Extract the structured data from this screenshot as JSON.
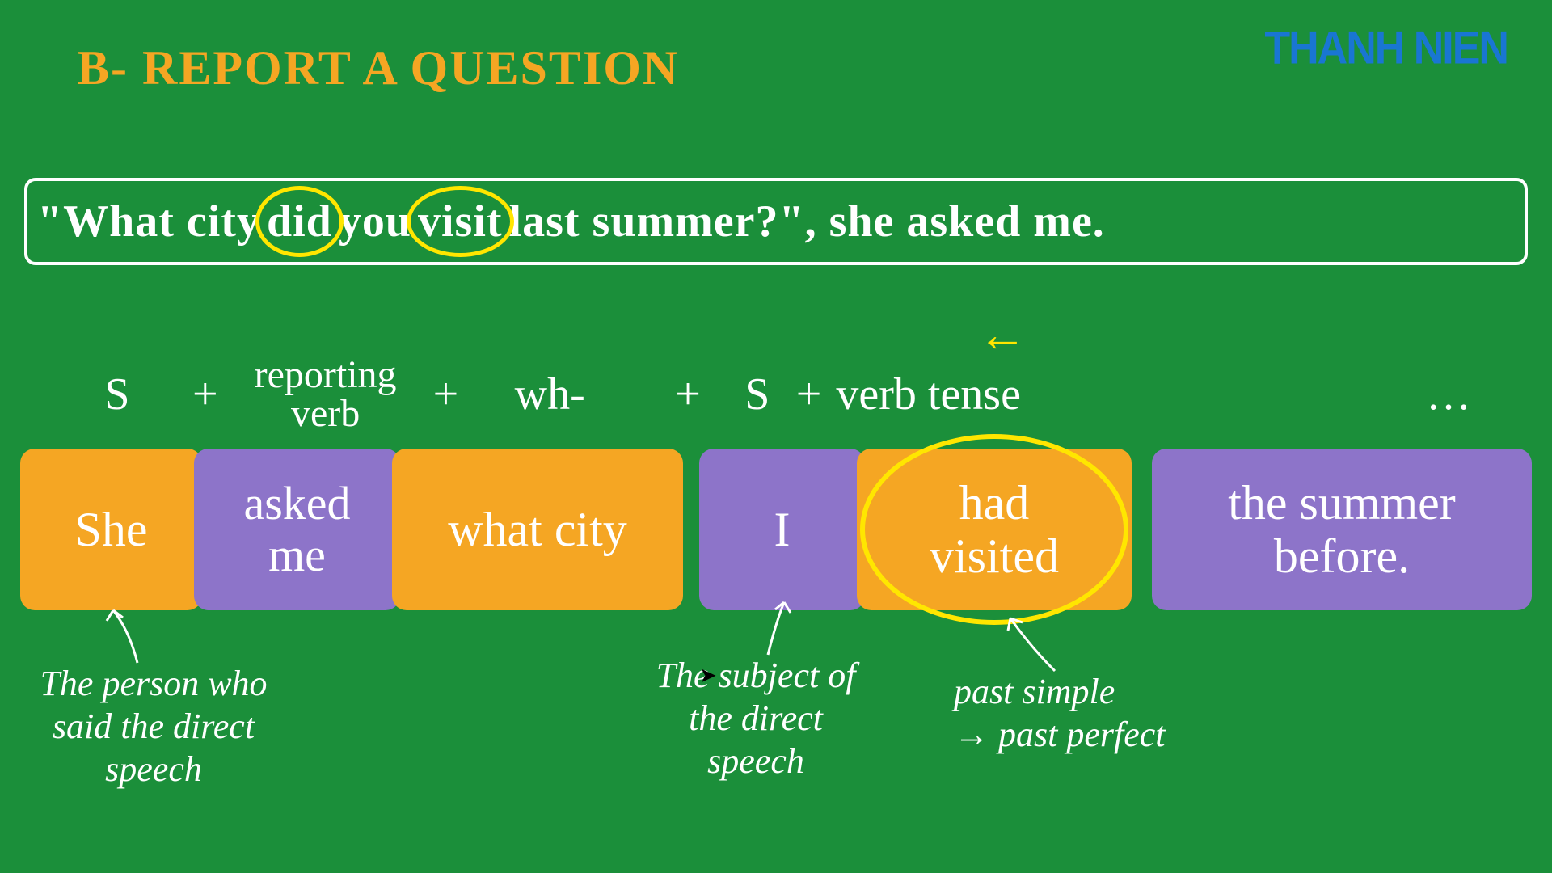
{
  "title": "B- REPORT A QUESTION",
  "logo": "THANH NIEN",
  "sentence": {
    "p1": "\"What city ",
    "c1": "did",
    "p2": " you ",
    "c2": "visit",
    "p3": " last summer?\", she asked me."
  },
  "formula": {
    "s": "S",
    "plus": "+",
    "reporting1": "reporting",
    "reporting2": "verb",
    "wh": "wh-",
    "s2": "S",
    "verb": "verb tense",
    "dots": "…"
  },
  "arrow": "←",
  "blocks": {
    "she": "She",
    "asked1": "asked",
    "asked2": "me",
    "what": "what city",
    "i": "I",
    "had1": "had",
    "had2": "visited",
    "summer1": "the summer",
    "summer2": "before."
  },
  "annotations": {
    "a1": "The person who said the direct speech",
    "a2": "The subject of the direct speech",
    "a3a": "past simple",
    "a3b": "→ past perfect"
  }
}
